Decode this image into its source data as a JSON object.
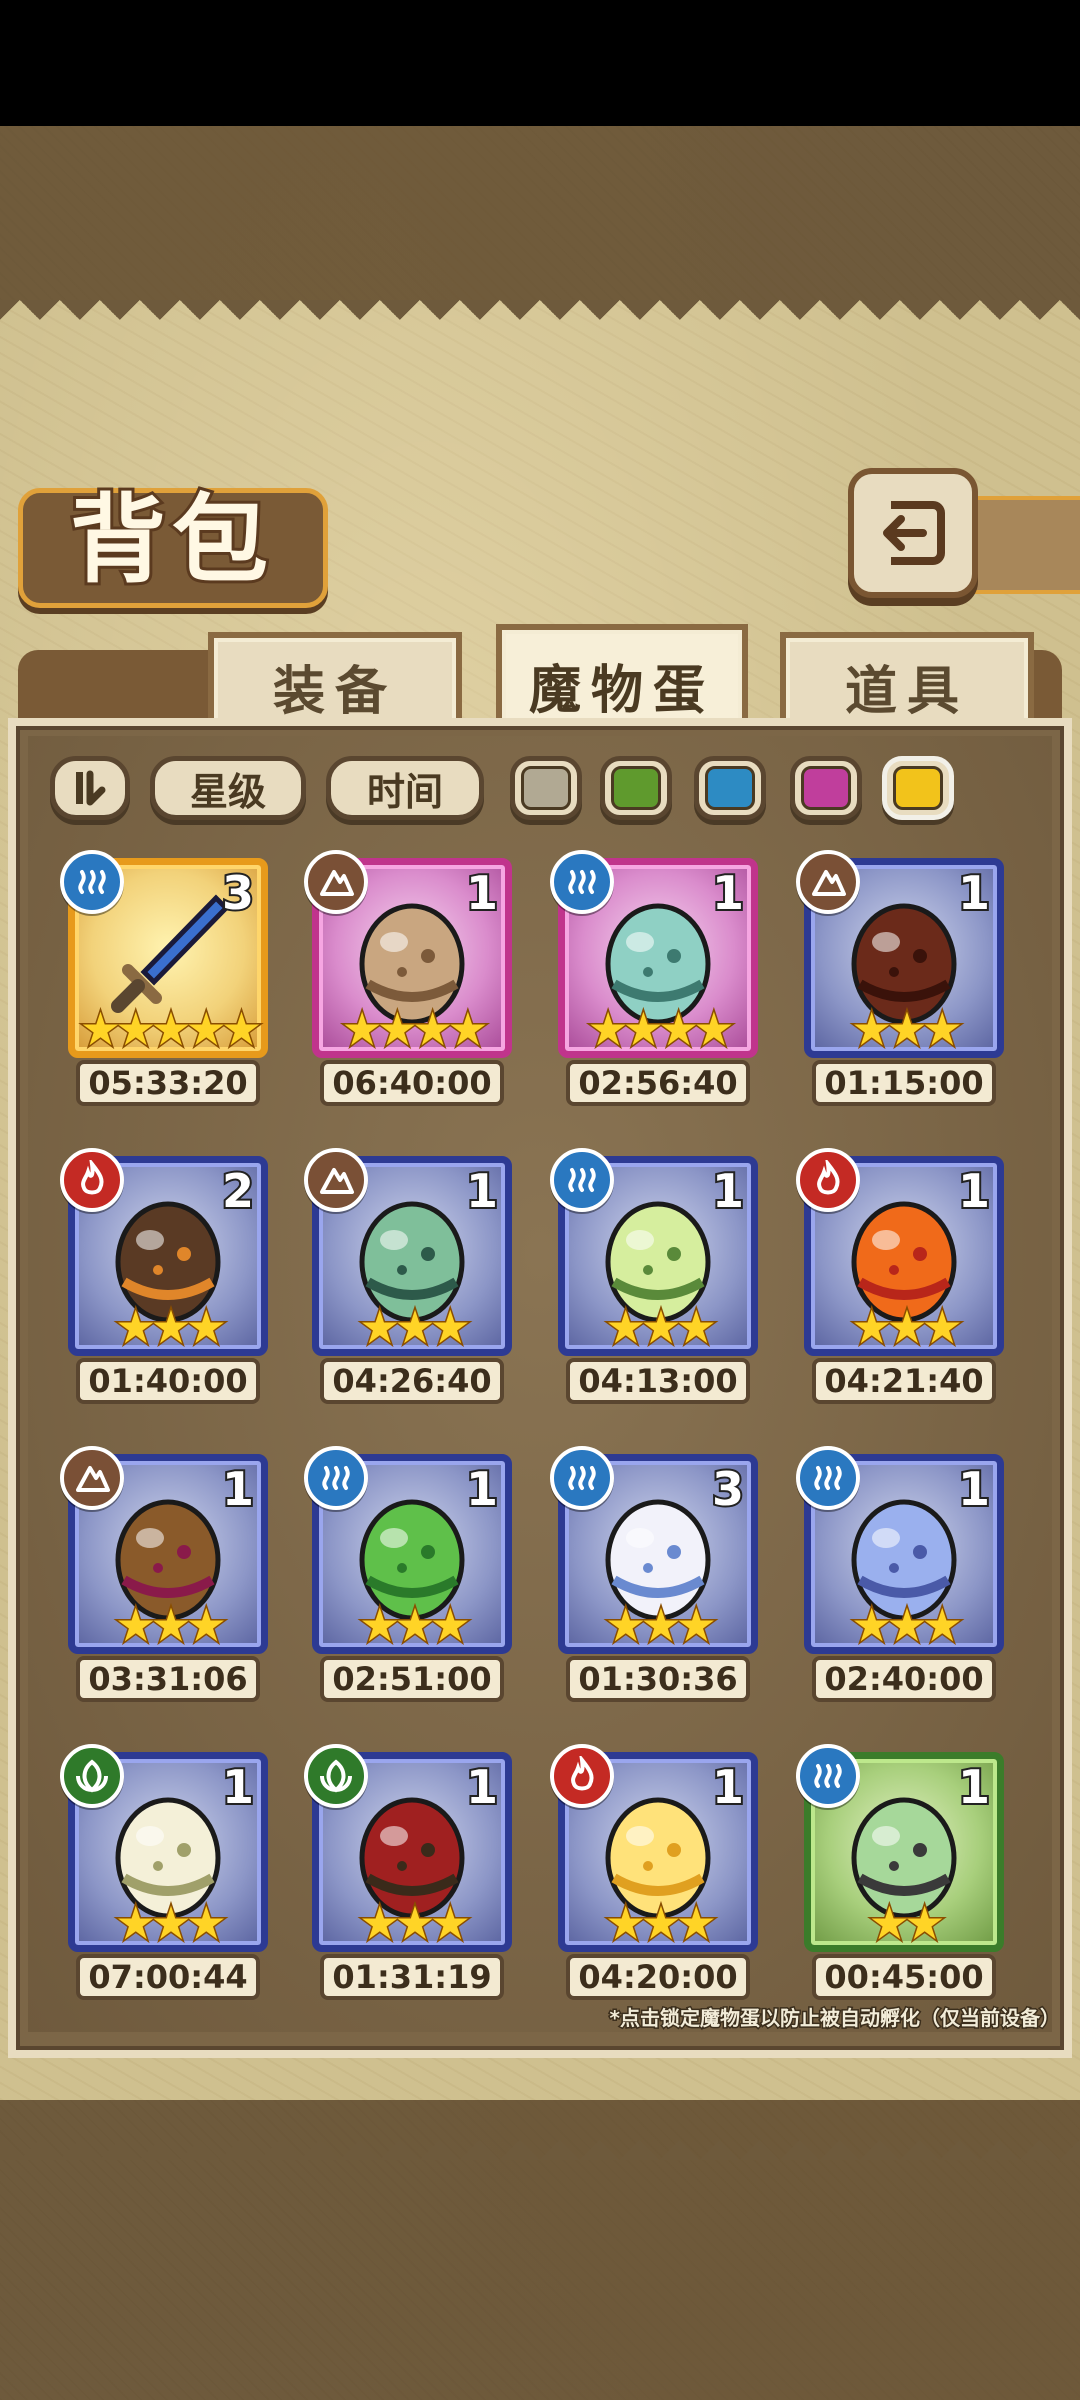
{
  "page": {
    "title": "背包",
    "back_label": "back"
  },
  "tabs": [
    {
      "label": "装备",
      "active": false
    },
    {
      "label": "魔物蛋",
      "active": true
    },
    {
      "label": "道具",
      "active": false
    }
  ],
  "filters": {
    "sort_label": "星级",
    "time_label": "时间",
    "color_swatches": [
      {
        "color": "#b1a993",
        "selected": false
      },
      {
        "color": "#5f9a2d",
        "selected": false
      },
      {
        "color": "#2d8bc3",
        "selected": false
      },
      {
        "color": "#c03e9c",
        "selected": false
      },
      {
        "color": "#f2c31b",
        "selected": true
      }
    ]
  },
  "eggs": [
    {
      "element": "water",
      "frame": "gold",
      "count": "3",
      "stars": 5,
      "time": "05:33:20",
      "art": "sword-icon"
    },
    {
      "element": "earth",
      "frame": "pink",
      "count": "1",
      "stars": 4,
      "time": "06:40:00",
      "art": "fuzzy-egg-icon"
    },
    {
      "element": "water",
      "frame": "pink",
      "count": "1",
      "stars": 4,
      "time": "02:56:40",
      "art": "netted-egg-icon"
    },
    {
      "element": "earth",
      "frame": "blue",
      "count": "1",
      "stars": 3,
      "time": "01:15:00",
      "art": "chocolate-egg-icon"
    },
    {
      "element": "fire",
      "frame": "blue",
      "count": "2",
      "stars": 3,
      "time": "01:40:00",
      "art": "furry-egg-icon"
    },
    {
      "element": "earth",
      "frame": "blue",
      "count": "1",
      "stars": 3,
      "time": "04:26:40",
      "art": "cloaked-egg-icon"
    },
    {
      "element": "water",
      "frame": "blue",
      "count": "1",
      "stars": 3,
      "time": "04:13:00",
      "art": "striped-egg-icon"
    },
    {
      "element": "fire",
      "frame": "blue",
      "count": "1",
      "stars": 3,
      "time": "04:21:40",
      "art": "flame-egg-icon"
    },
    {
      "element": "earth",
      "frame": "blue",
      "count": "1",
      "stars": 3,
      "time": "03:31:06",
      "art": "berry-egg-icon"
    },
    {
      "element": "water",
      "frame": "blue",
      "count": "1",
      "stars": 3,
      "time": "02:51:00",
      "art": "slime-egg-icon"
    },
    {
      "element": "water",
      "frame": "blue",
      "count": "3",
      "stars": 3,
      "time": "01:30:36",
      "art": "ribbon-egg-icon"
    },
    {
      "element": "water",
      "frame": "blue",
      "count": "1",
      "stars": 3,
      "time": "02:40:00",
      "art": "crystal-egg-icon"
    },
    {
      "element": "grass",
      "frame": "blue",
      "count": "1",
      "stars": 3,
      "time": "07:00:44",
      "art": "bud-egg-icon"
    },
    {
      "element": "grass",
      "frame": "blue",
      "count": "1",
      "stars": 3,
      "time": "01:31:19",
      "art": "dotted-egg-icon"
    },
    {
      "element": "fire",
      "frame": "blue",
      "count": "1",
      "stars": 3,
      "time": "04:20:00",
      "art": "sun-egg-icon"
    },
    {
      "element": "water",
      "frame": "green",
      "count": "1",
      "stars": 2,
      "time": "00:45:00",
      "art": "moss-egg-icon"
    }
  ],
  "element_colors": {
    "water": "#2a78c0",
    "earth": "#7a5036",
    "fire": "#c42a24",
    "grass": "#2f7a2a"
  },
  "hint": "*点击锁定魔物蛋以防止被自动孵化（仅当前设备）"
}
